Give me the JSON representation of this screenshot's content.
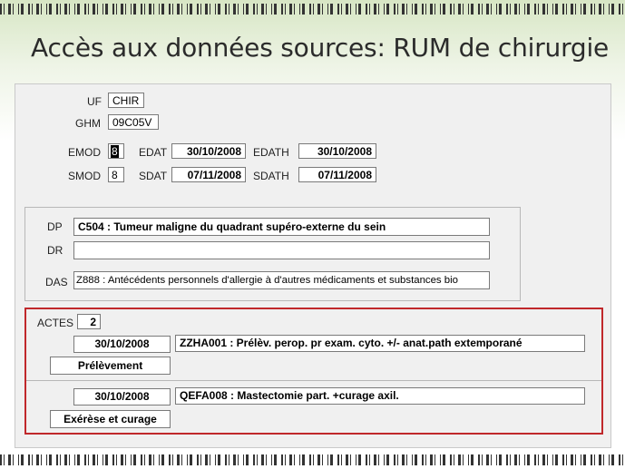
{
  "slide": {
    "title": "Accès aux données sources: RUM de chirurgie"
  },
  "header": {
    "uf": {
      "label": "UF",
      "value": "CHIR"
    },
    "ghm": {
      "label": "GHM",
      "value": "09C05V"
    },
    "emod": {
      "label": "EMOD",
      "value": "8"
    },
    "edat": {
      "label": "EDAT",
      "value": "30/10/2008"
    },
    "edath": {
      "label": "EDATH",
      "value": "30/10/2008"
    },
    "smod": {
      "label": "SMOD",
      "value": "8"
    },
    "sdat": {
      "label": "SDAT",
      "value": "07/11/2008"
    },
    "sdath": {
      "label": "SDATH",
      "value": "07/11/2008"
    }
  },
  "diagnoses": {
    "dp": {
      "label": "DP",
      "value": "C504 : Tumeur maligne du quadrant supéro-externe du sein"
    },
    "dr": {
      "label": "DR",
      "value": ""
    },
    "das": {
      "label": "DAS",
      "value": "Z888 : Antécédents personnels d'allergie à d'autres médicaments et substances bio"
    }
  },
  "actes": {
    "label": "ACTES",
    "count": "2",
    "items": [
      {
        "date": "30/10/2008",
        "code": "ZZHA001 : Prélèv. perop. pr exam. cyto. +/- anat.path extemporané",
        "type": "Prélèvement"
      },
      {
        "date": "30/10/2008",
        "code": "QEFA008 : Mastectomie part. +curage axil.",
        "type": "Exérèse et curage"
      }
    ]
  },
  "colors": {
    "highlight_border": "#c0282b"
  }
}
